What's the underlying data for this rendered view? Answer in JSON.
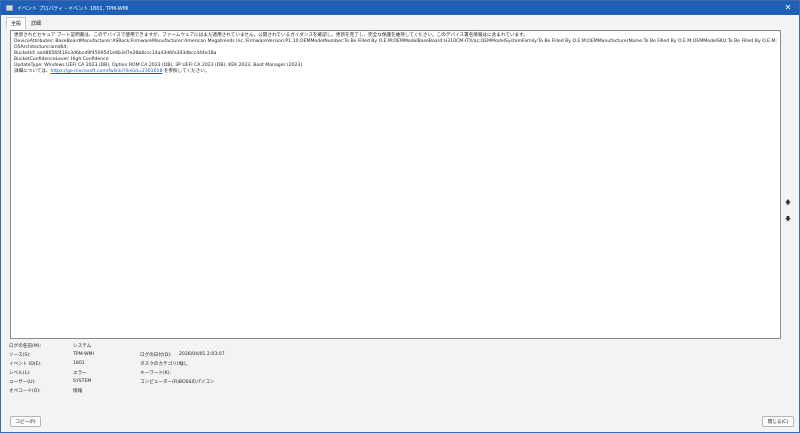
{
  "window": {
    "title": "イベント プロパティ - イベント 1801, TPM-WMI",
    "close_label": "✕"
  },
  "tabs": [
    {
      "label": "全般",
      "active": true
    },
    {
      "label": "詳細",
      "active": false
    }
  ],
  "message": {
    "line1": "更新されたセキュア ブート証明書は、このデバイスで使用できますが、ファームウェアにはまだ適用されていません。公開されているガイダンスを確認し、更新を完了し、完全な保護を維持してください。このデバイス署名情報はに含まれています。",
    "line2": "DeviceAttributes: BaseBoardManufacturer:ASRock;FirmwareManufacturer:American Megatrends Inc.;FirmwareVersion:P1.10;OEMModelNumber:To Be Filled By O.E.M;OEMModelBaseBoard:H310CM-ITX/ac;OEMModelSystemFamily:To Be Filled By O.E.M;OEMManufacturerName:To Be Filled By O.E.M;OEMModelSKU:To Be Filled By O.E.M;OSArchitecture:amd64;",
    "line3": "BucketId: aad8656f416c3d6bcd9f45095d1e6b3d7e28b8ccc14a43d6fe343dbcc444e18a",
    "line4": "BucketConfidenceLevel: High Confidence",
    "line5": "UpdateType: Windows UEFI CA 2023 (DB), Option ROM CA 2023 (DB), 3P UEFI CA 2023 (DB), KEK 2023, Boot Manager (2023)",
    "line6_prefix": "詳細については、",
    "link": "https://go.microsoft.com/fwlink/?linkid=2301018",
    "line6_suffix": " を参照してください。"
  },
  "nav": {
    "up_label": "🡅",
    "down_label": "🡇"
  },
  "properties": {
    "log_name_label": "ログの名前(M):",
    "log_name_value": "システム",
    "source_label": "ソース(S):",
    "source_value": "TPM-WMI",
    "logged_label": "ログの日付(D):",
    "logged_value": "2026/04/01 2:03:07",
    "event_id_label": "イベント ID(E):",
    "event_id_value": "1801",
    "task_category_label": "タスクのカテゴリ(Y):",
    "task_category_value": "なし",
    "level_label": "レベル(L):",
    "level_value": "エラー",
    "keywords_label": "キーワード(K):",
    "keywords_value": "",
    "user_label": "ユーザー(U):",
    "user_value": "SYSTEM",
    "computer_label": "コンピューター(R):",
    "computer_value": "BOSSのパソコン",
    "opcode_label": "オペコード(O):",
    "opcode_value": "情報"
  },
  "buttons": {
    "copy_label": "コピー(P)",
    "close_label": "閉じる(C)"
  }
}
